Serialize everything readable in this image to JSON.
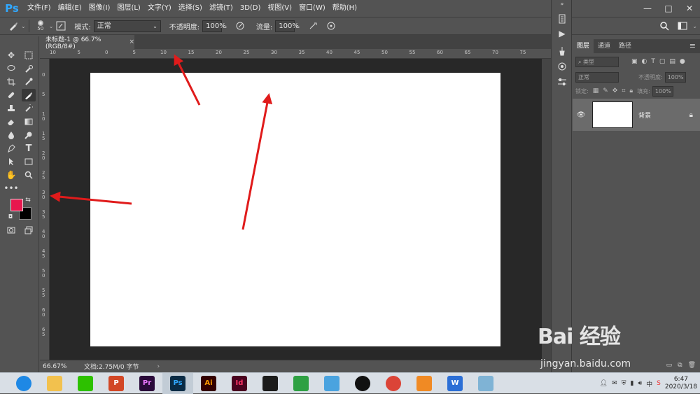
{
  "app": {
    "logo": "Ps"
  },
  "menu": [
    "文件(F)",
    "编辑(E)",
    "图像(I)",
    "图层(L)",
    "文字(Y)",
    "选择(S)",
    "滤镜(T)",
    "3D(D)",
    "视图(V)",
    "窗口(W)",
    "帮助(H)"
  ],
  "window_controls": {
    "minimize": "—",
    "maximize": "□",
    "close": "✕"
  },
  "options": {
    "brush_size": "50",
    "mode_label": "模式:",
    "mode_value": "正常",
    "opacity_label": "不透明度:",
    "opacity_value": "100%",
    "flow_label": "流量:",
    "flow_value": "100%"
  },
  "document": {
    "tab_title": "未标题-1 @ 66.7%(RGB/8#)",
    "close": "×",
    "zoom": "66.67%",
    "doc_info": "文档:2.75M/0 字节",
    "ruler_h_labels": [
      "10",
      "5",
      "0",
      "5",
      "10",
      "15",
      "20",
      "25",
      "30",
      "35",
      "40",
      "45",
      "50",
      "55",
      "60",
      "65",
      "70",
      "75"
    ],
    "ruler_v_labels": [
      "0",
      "5",
      "1 0",
      "1 5",
      "2 0",
      "2 5",
      "3 0",
      "3 5",
      "4 0",
      "4 5",
      "5 0",
      "5 5",
      "6 0",
      "6 5"
    ]
  },
  "layers_panel": {
    "tabs": [
      "图层",
      "通道",
      "路径"
    ],
    "filter_label": "类型",
    "blend_mode": "正常",
    "opacity_label": "不透明度:",
    "opacity_value": "100%",
    "lock_label": "锁定:",
    "fill_label": "填充:",
    "fill_value": "100%",
    "layer_name": "背景"
  },
  "colors": {
    "foreground": "#e8174e",
    "background": "#000000",
    "arrow": "#e01b1b"
  },
  "taskbar": {
    "apps": [
      {
        "name": "browser",
        "label": "",
        "color": "#1e88e5"
      },
      {
        "name": "explorer",
        "label": "",
        "color": "#f2c14e"
      },
      {
        "name": "wechat",
        "label": "",
        "color": "#2dc100"
      },
      {
        "name": "powerpoint",
        "label": "P",
        "color": "#d24726"
      },
      {
        "name": "premiere",
        "label": "Pr",
        "color": "#2a0a3a"
      },
      {
        "name": "photoshop",
        "label": "Ps",
        "color": "#0a2b45"
      },
      {
        "name": "illustrator",
        "label": "Ai",
        "color": "#330000"
      },
      {
        "name": "indesign",
        "label": "Id",
        "color": "#49021f"
      },
      {
        "name": "video-editor",
        "label": "",
        "color": "#1b1b1b"
      },
      {
        "name": "app-colorful",
        "label": "",
        "color": "#2ea043"
      },
      {
        "name": "app-cloud",
        "label": "",
        "color": "#4aa3df"
      },
      {
        "name": "qq",
        "label": "",
        "color": "#111111"
      },
      {
        "name": "chrome",
        "label": "",
        "color": "#db4437"
      },
      {
        "name": "app-orange",
        "label": "",
        "color": "#f08a24"
      },
      {
        "name": "wps",
        "label": "W",
        "color": "#2c6fd6"
      },
      {
        "name": "app-book",
        "label": "",
        "color": "#7fb3d5"
      }
    ],
    "time": "6:47",
    "date": "2020/3/18"
  },
  "watermark": {
    "main": "Bai 经验",
    "sub": "jingyan.baidu.com"
  }
}
